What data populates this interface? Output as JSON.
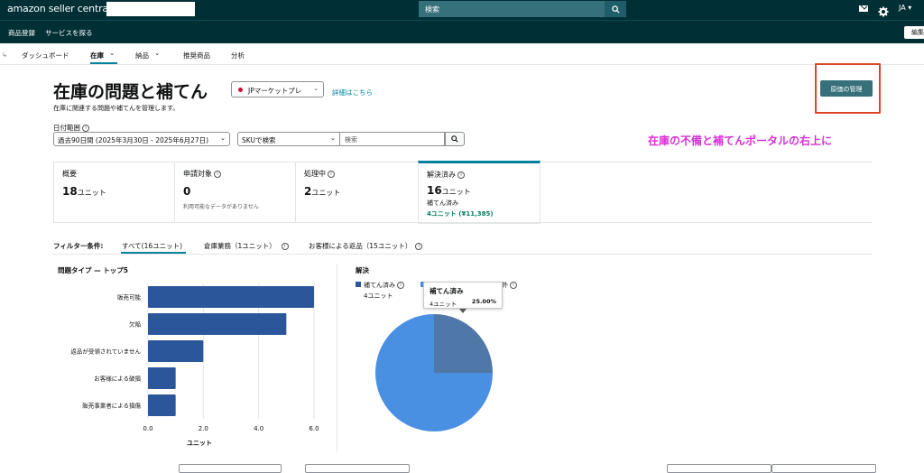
{
  "topbar": {
    "logo": "amazon seller central",
    "search_placeholder": "検索",
    "lang": "JA ▾",
    "icons": [
      "search-icon",
      "mail-icon",
      "gear-icon"
    ]
  },
  "subbar": {
    "items": [
      "商品登録",
      "サービスを探る"
    ],
    "edit": "編集"
  },
  "nav": {
    "breadcrumb_arrow": "↳",
    "items": [
      "ダッシュボード",
      "在庫",
      "納品",
      "推奨商品",
      "分析"
    ],
    "active": "在庫"
  },
  "page": {
    "title": "在庫の問題と補てん",
    "marketplace": "JPマーケットプレ",
    "details_link": "詳細はこちら",
    "subtitle": "在庫に関連する問題や補てんを管理します。",
    "cost_button": "原価の管理",
    "annotation": "在庫の不備と補てんポータルの右上に"
  },
  "filters": {
    "date_label": "日付範囲",
    "date_value": "過去90日間 (2025年3月30日 - 2025年6月27日)",
    "sku_select": "SKUで検索",
    "search_placeholder": "検索"
  },
  "cards": [
    {
      "label": "概要",
      "value": "18",
      "unit": "ユニット",
      "note": ""
    },
    {
      "label": "申請対象",
      "value": "0",
      "unit": "",
      "note": "利用可能なデータがありません"
    },
    {
      "label": "処理中",
      "value": "2",
      "unit": "ユニット",
      "note": ""
    },
    {
      "label": "解決済み",
      "value": "16",
      "unit": "ユニット",
      "sub1": "補てん済み",
      "sub2": "4ユニット (¥11,385)"
    }
  ],
  "filter_tabs": {
    "label": "フィルター条件:",
    "tabs": [
      "すべて(16ユニット)",
      "倉庫業務（1ユニット）",
      "お客様による返品（15ユニット）"
    ]
  },
  "bar_chart": {
    "title": "問題タイプ — トップ5",
    "xlabel": "ユニット"
  },
  "resolve": {
    "title": "解決",
    "legend_1": "補てん済み",
    "legend_1_sub": "4ユニット",
    "legend_2_tail": "外",
    "tooltip_title": "補てん済み",
    "tooltip_units": "4ユニット",
    "tooltip_pct": "25.00%"
  },
  "chart_data": [
    {
      "type": "bar",
      "orientation": "horizontal",
      "title": "問題タイプ — トップ5",
      "categories": [
        "販売可能",
        "欠陥",
        "返品が受領されていません",
        "お客様による破損",
        "販売事業者による損傷"
      ],
      "values": [
        6,
        5,
        2,
        1,
        1
      ],
      "xlabel": "ユニット",
      "xlim": [
        0,
        6
      ],
      "xticks": [
        "0.0",
        "2.0",
        "4.0",
        "6.0"
      ],
      "color": "#2b579a"
    },
    {
      "type": "pie",
      "title": "解決",
      "labels": [
        "補てん済み",
        ""
      ],
      "values": [
        4,
        12
      ],
      "colors": [
        "#4f77a8",
        "#4a90e2"
      ]
    }
  ]
}
